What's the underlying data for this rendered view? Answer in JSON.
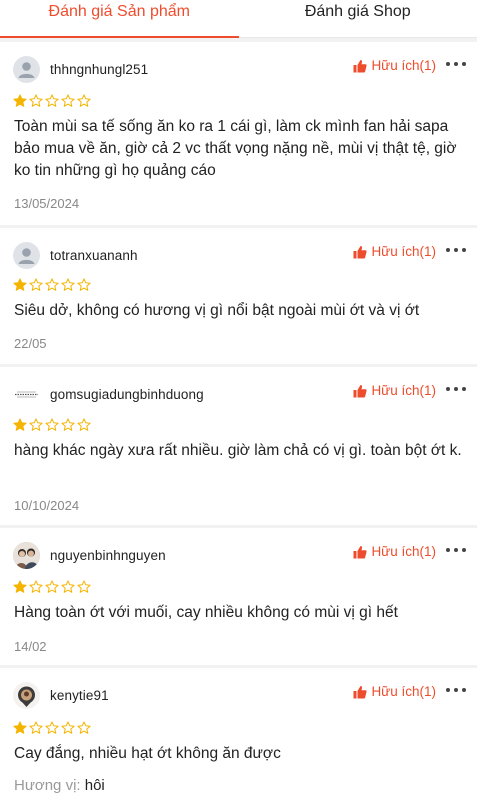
{
  "tabs": [
    {
      "label": "Đánh giá Sản phẩm"
    },
    {
      "label": "Đánh giá Shop"
    }
  ],
  "colors": {
    "accent": "#ee4d2d",
    "star": "#f5b400"
  },
  "helpful_label": "Hữu ích(1)",
  "reviews": [
    {
      "username": "thhngnhungl251",
      "avatar": "default-avatar",
      "rating": 1,
      "text": "Toàn mùi sa tế sống ăn ko ra 1 cái gì, làm ck mình fan hải sapa bảo mua về ăn, giờ cả 2 vc thất vọng nặng nề, mùi vị thật tệ, giờ ko tin những gì họ quảng cáo",
      "date": "13/05/2024"
    },
    {
      "username": "totranxuananh",
      "avatar": "default-avatar",
      "rating": 1,
      "text": "Siêu dở, không có hương vị gì nổi bật ngoài mùi ớt và vị ớt",
      "date": "22/05"
    },
    {
      "username": "gomsugiadungbinhduong",
      "avatar": "shop-logo-avatar",
      "rating": 1,
      "text": "hàng khác ngày xưa rất nhiều. giờ làm chả có vị gì. toàn bột ớt k.",
      "date": "10/10/2024"
    },
    {
      "username": "nguyenbinhnguyen",
      "avatar": "photo-avatar",
      "rating": 1,
      "text": "Hàng toàn ớt với muối, cay nhiều không có mùi vị gì hết",
      "date": "14/02"
    },
    {
      "username": "kenytie91",
      "avatar": "photo-avatar",
      "rating": 1,
      "text": "Cay đắng, nhiều hạt ớt không ăn được",
      "attr_label": "Hương vị:",
      "attr_value": "hôi"
    }
  ]
}
